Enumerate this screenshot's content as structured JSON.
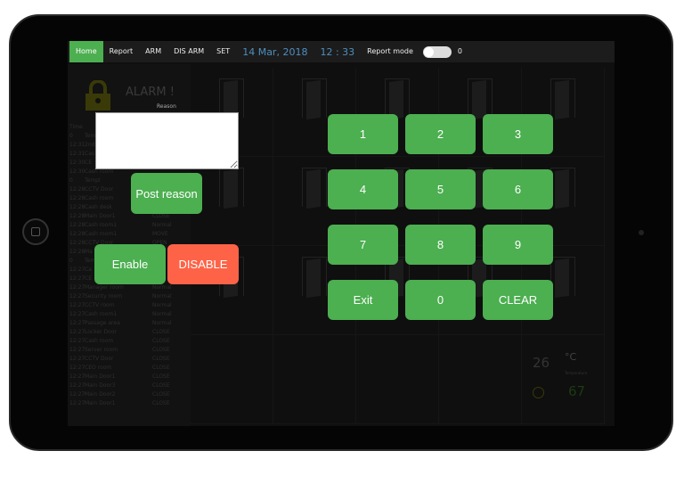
{
  "nav": {
    "items": [
      "Home",
      "Report",
      "ARM",
      "DIS ARM",
      "SET"
    ],
    "date": "14 Mar, 2018",
    "time": "12 : 33",
    "report_mode_label": "Report mode",
    "report_mode_value": "0",
    "report_mode_on": false
  },
  "alarm": {
    "title": "ALARM !",
    "reason_label": "Reason",
    "reason_value": "",
    "post_reason": "Post reason",
    "enable": "Enable",
    "disable": "DISABLE"
  },
  "log": {
    "header": [
      "Time",
      "",
      ""
    ],
    "rows": [
      [
        "0",
        "Templ",
        ""
      ],
      [
        "12:31",
        "2nd",
        ""
      ],
      [
        "12:31",
        "Cas",
        ""
      ],
      [
        "12:30",
        "CE",
        ""
      ],
      [
        "12:30",
        "Cash room",
        ""
      ],
      [
        "0",
        "Templ",
        ""
      ],
      [
        "12:28",
        "CCTV Door",
        ""
      ],
      [
        "12:28",
        "Cash room",
        ""
      ],
      [
        "12:28",
        "Cash desk",
        ""
      ],
      [
        "12:28",
        "Main Door1",
        "CLOSE"
      ],
      [
        "12:28",
        "Cash room1",
        "Normal"
      ],
      [
        "12:28",
        "Cash room1",
        "MOVE"
      ],
      [
        "12:28",
        "CCTV Door",
        "OPEN"
      ],
      [
        "12:28",
        "Ma",
        ""
      ],
      [
        "0",
        "Tem",
        ""
      ],
      [
        "12:27",
        "Ca",
        ""
      ],
      [
        "12:27",
        "CE",
        ""
      ],
      [
        "12:27",
        "Manager room",
        "Normal"
      ],
      [
        "12:27",
        "Security room",
        "Normal"
      ],
      [
        "12:27",
        "CCTV room",
        "Normal"
      ],
      [
        "12:27",
        "Cash room1",
        "Normal"
      ],
      [
        "12:27",
        "Passage area",
        "Normal"
      ],
      [
        "12:27",
        "Locker Door",
        "CLOSE"
      ],
      [
        "12:27",
        "Cash room",
        "CLOSE"
      ],
      [
        "12:27",
        "Server room",
        "CLOSE"
      ],
      [
        "12:27",
        "CCTV Door",
        "CLOSE"
      ],
      [
        "12:27",
        "CEO room",
        "CLOSE"
      ],
      [
        "12:27",
        "Main Door1",
        "CLOSE"
      ],
      [
        "12:27",
        "Main Door3",
        "CLOSE"
      ],
      [
        "12:27",
        "Main Door2",
        "CLOSE"
      ],
      [
        "12:27",
        "Main Door1",
        "CLOSE"
      ]
    ]
  },
  "keypad": [
    "1",
    "2",
    "3",
    "4",
    "5",
    "6",
    "7",
    "8",
    "9",
    "Exit",
    "0",
    "CLEAR"
  ],
  "sensor": {
    "temperature": "26",
    "unit": "°C",
    "temperature_label": "Temperature",
    "humidity": "67"
  },
  "colors": {
    "green": "#4caf50",
    "red": "#ff6347",
    "date_blue": "#4e8fc0"
  }
}
